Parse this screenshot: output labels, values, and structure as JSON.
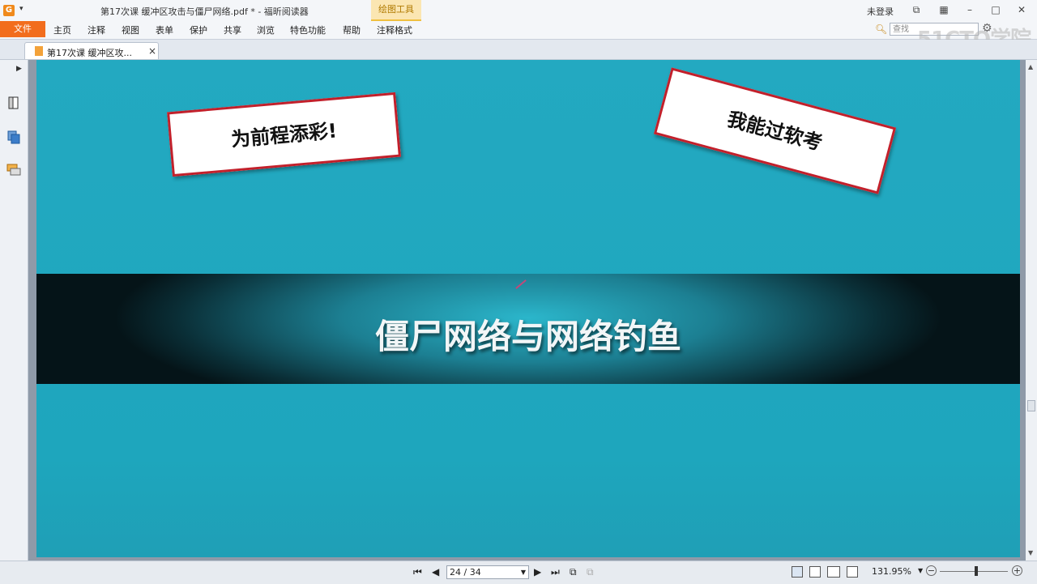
{
  "titlebar": {
    "app_icon": "G",
    "window_title": "第17次课 缓冲区攻击与僵尸网络.pdf * - 福昕阅读器",
    "context_tab": "绘图工具",
    "login": "未登录"
  },
  "menu": {
    "file": "文件",
    "items": [
      "主页",
      "注释",
      "视图",
      "表单",
      "保护",
      "共享",
      "浏览",
      "特色功能",
      "帮助",
      "注释格式"
    ],
    "search_placeholder": "查找"
  },
  "watermark": "51CTO学院",
  "doc_tab": {
    "label": "第17次课 缓冲区攻...",
    "close": "×"
  },
  "slide": {
    "sign_left": "为前程添彩!",
    "sign_right": "我能过软考",
    "banner_title": "僵尸网络与网络钓鱼"
  },
  "status": {
    "page_indicator": "24 / 34",
    "zoom": "131.95%"
  },
  "colors": {
    "slide_bg": "#23a9c1",
    "sign_border": "#c2202b",
    "file_button": "#f26d1d"
  }
}
